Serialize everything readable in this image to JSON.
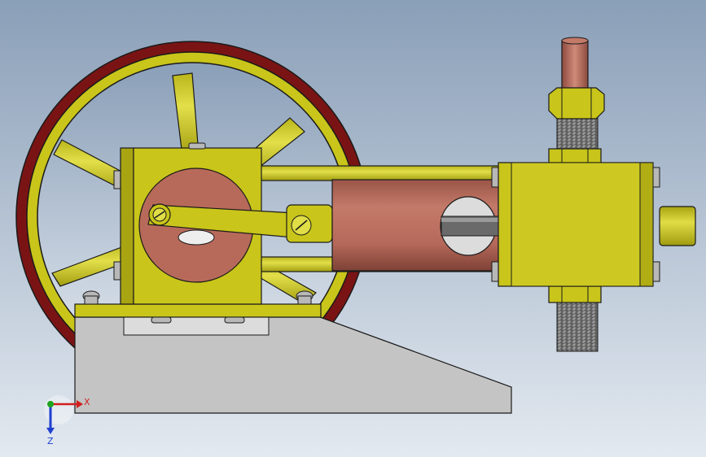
{
  "viewport": {
    "background_top": "#8a9fb8",
    "background_bottom": "#e3e9f0"
  },
  "colors": {
    "brass": "#c9c51a",
    "brass_light": "#dedb3a",
    "brass_dark": "#9f9b10",
    "rim_red": "#7a1414",
    "copper": "#b86a5a",
    "copper_dark": "#8c4a3e",
    "base_grey": "#c4c4c4",
    "bolt_grey": "#b8b8b8",
    "thread_grey": "#8a8a8a",
    "outline": "#1a1a1a"
  },
  "triad": {
    "x_label": "X",
    "z_label": "Z",
    "x_color": "#d11f1f",
    "y_color": "#1fa51f",
    "z_color": "#1f3fd1"
  }
}
